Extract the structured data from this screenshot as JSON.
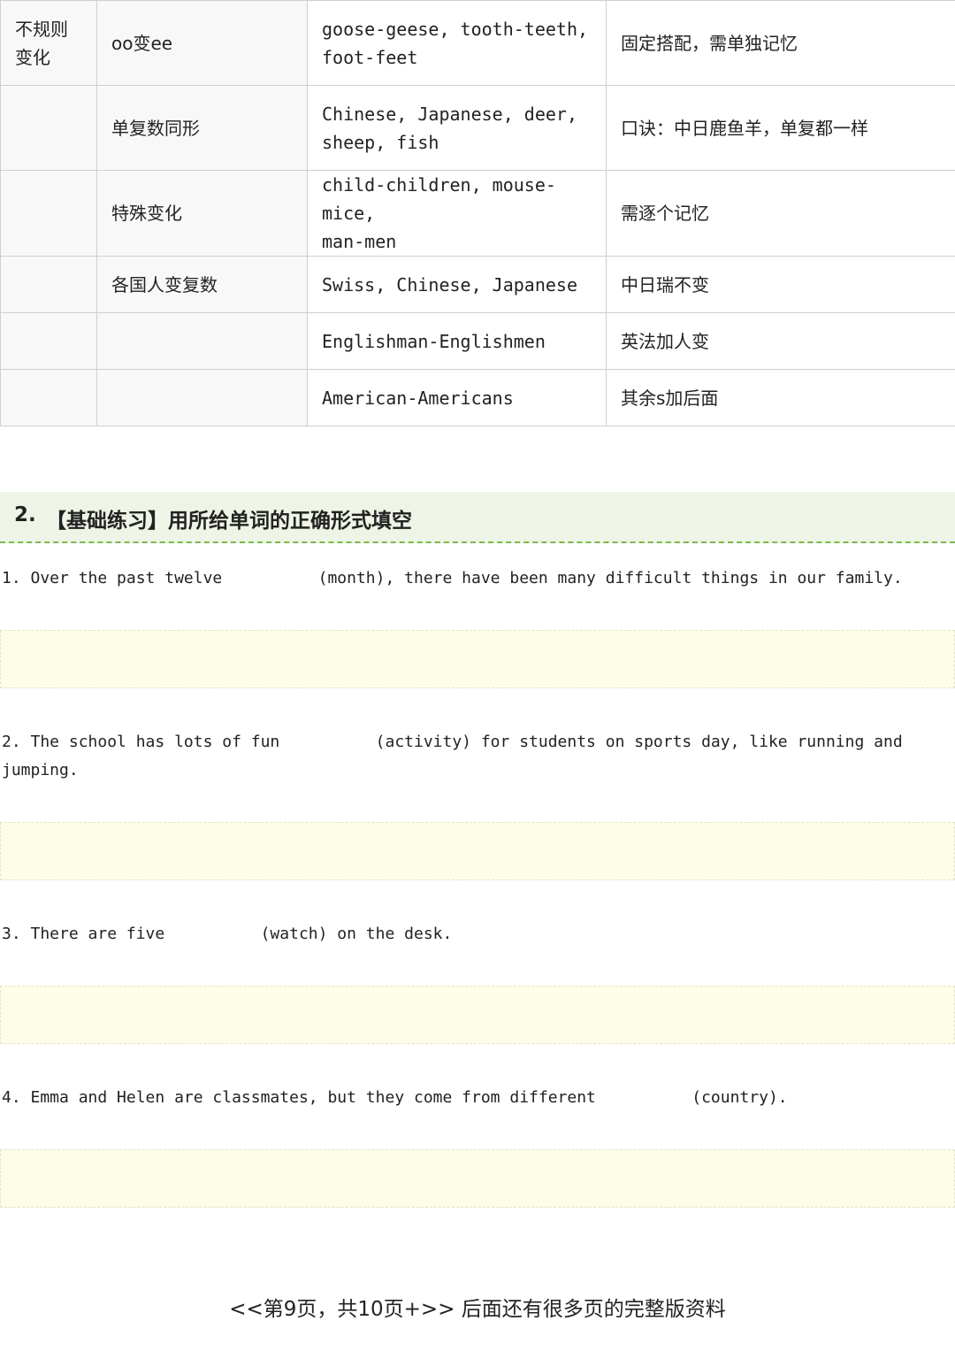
{
  "table": {
    "rows": [
      {
        "type": "不规则\n变化",
        "rule": "oo变ee",
        "examples": "goose-geese, tooth-teeth,\nfoot-feet",
        "note": "固定搭配，需单独记忆"
      },
      {
        "type": "",
        "rule": "单复数同形",
        "examples": "Chinese, Japanese, deer,\nsheep, fish",
        "note": "口诀：中日鹿鱼羊，单复都一样"
      },
      {
        "type": "",
        "rule": "特殊变化",
        "examples": "child-children, mouse-mice,\nman-men",
        "note": "需逐个记忆"
      },
      {
        "type": "",
        "rule": "各国人变复数",
        "examples": "Swiss, Chinese, Japanese",
        "note": "中日瑞不变"
      },
      {
        "type": "",
        "rule": "",
        "examples": "Englishman-Englishmen",
        "note": "英法加人变"
      },
      {
        "type": "",
        "rule": "",
        "examples": "American-Americans",
        "note": "其余s加后面"
      }
    ]
  },
  "section": {
    "number": "2.",
    "title": "【基础练习】用所给单词的正确形式填空"
  },
  "questions": [
    {
      "text": "1. Over the past twelve          (month), there have been many difficult things in our family."
    },
    {
      "text": "2. The school has lots of fun          (activity) for students on sports day, like running and\njumping."
    },
    {
      "text": "3. There are five          (watch) on the desk."
    },
    {
      "text": "4. Emma and Helen are classmates, but they come from different          (country)."
    }
  ],
  "footer": {
    "text": "<<第9页，共10页+>> 后面还有很多页的完整版资料"
  }
}
